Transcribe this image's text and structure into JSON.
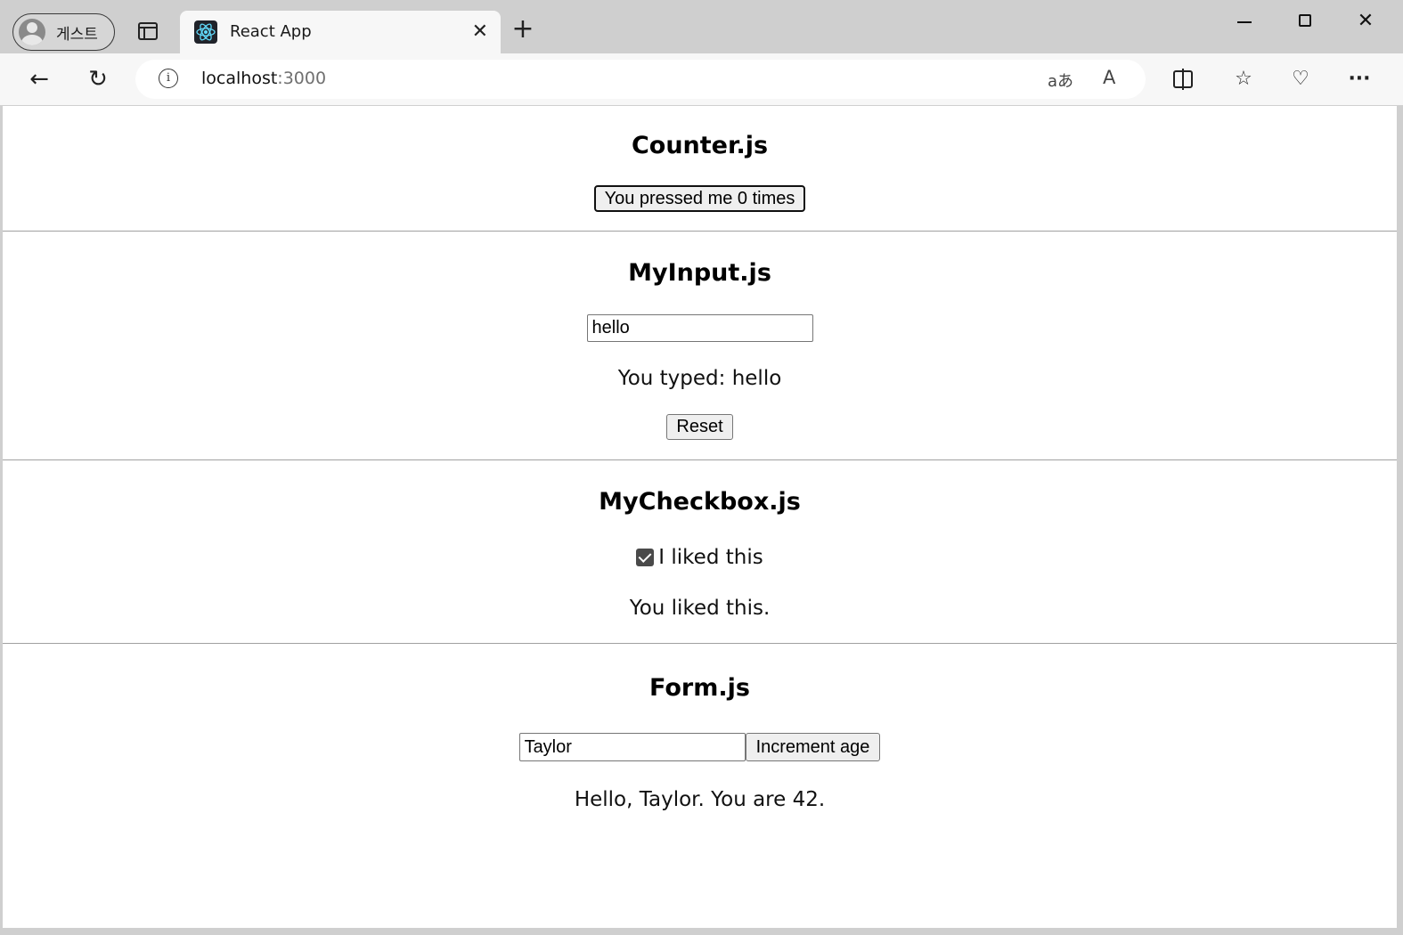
{
  "browser": {
    "profile_label": "게스트",
    "tab_title": "React App",
    "tab_close_glyph": "✕",
    "new_tab_glyph": "+",
    "window_close_glyph": "✕",
    "url_host": "localhost",
    "url_port": ":3000",
    "info_glyph": "i",
    "translate_glyph": "aあ",
    "read_aloud_glyph": "A",
    "back_glyph": "←",
    "reload_glyph": "↻",
    "favorites_glyph": "☆",
    "health_glyph": "♡",
    "more_glyph": "···"
  },
  "counter": {
    "heading": "Counter.js",
    "button_label": "You pressed me 0 times"
  },
  "my_input": {
    "heading": "MyInput.js",
    "input_value": "hello",
    "typed_text": "You typed: hello",
    "reset_label": "Reset"
  },
  "my_checkbox": {
    "heading": "MyCheckbox.js",
    "checkbox_label": "I liked this",
    "checked": true,
    "status_text": "You liked this."
  },
  "form": {
    "heading": "Form.js",
    "name_value": "Taylor",
    "increment_label": "Increment age",
    "greeting": "Hello, Taylor. You are 42."
  }
}
